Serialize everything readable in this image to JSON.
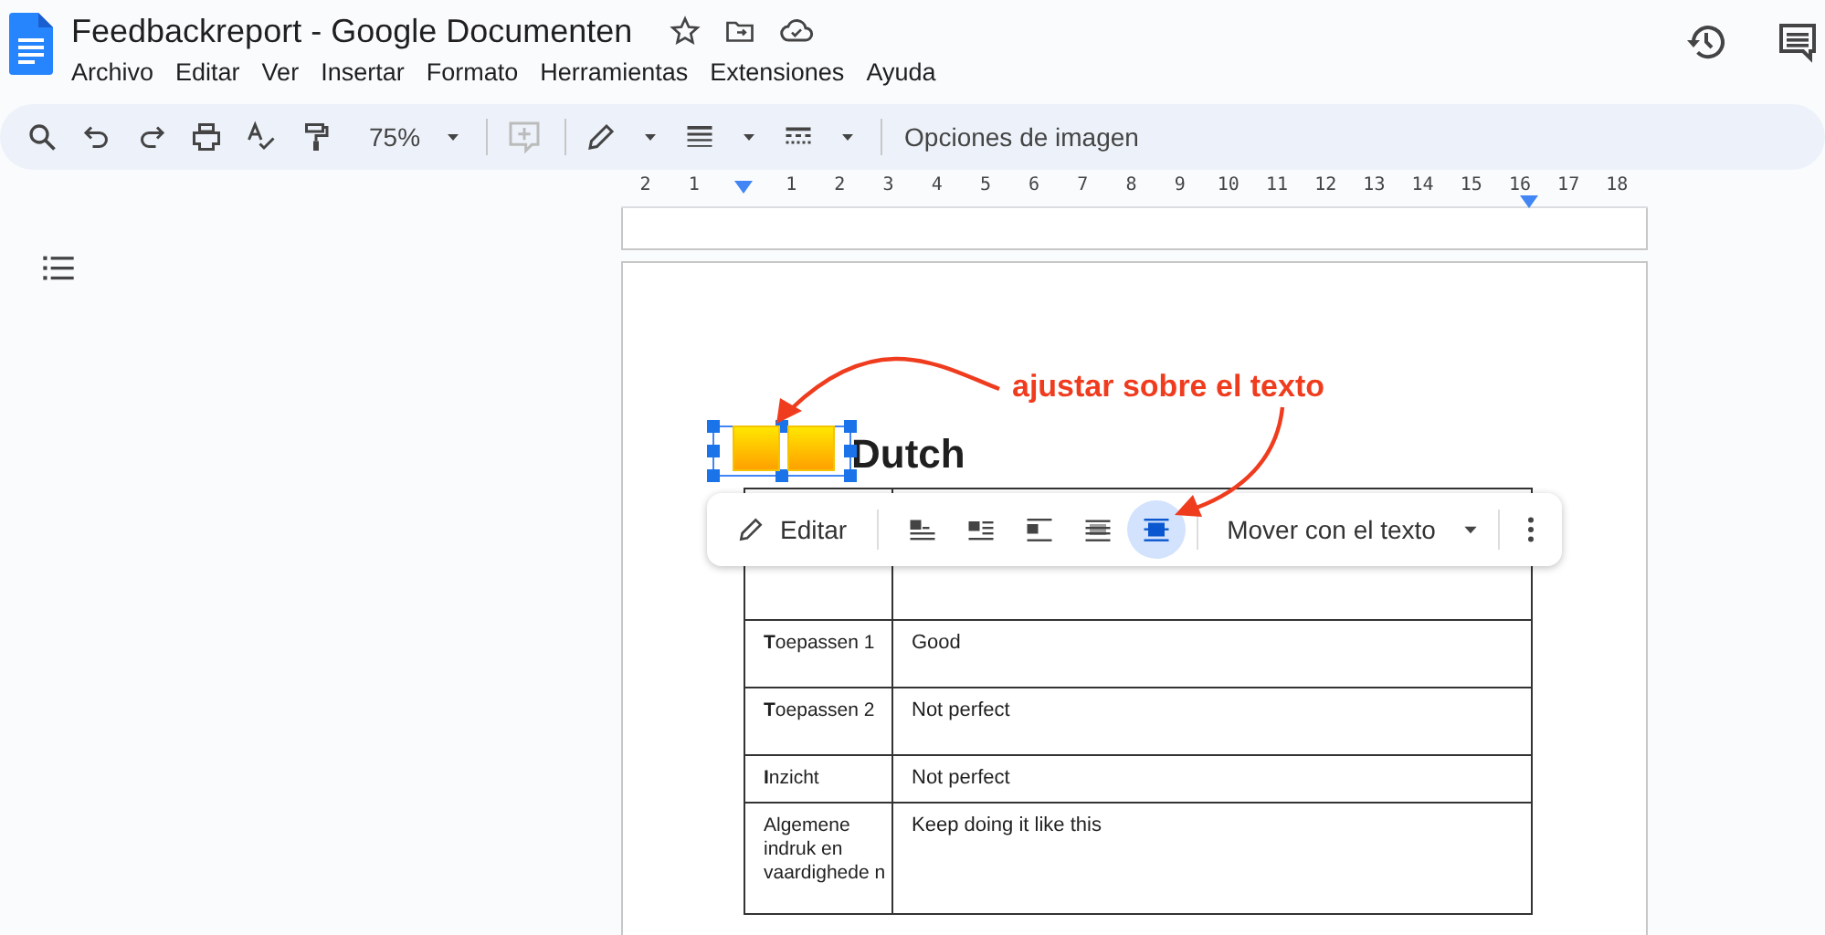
{
  "app": {
    "title": "Feedbackreport - Google Documenten"
  },
  "menu": [
    "Archivo",
    "Editar",
    "Ver",
    "Insertar",
    "Formato",
    "Herramientas",
    "Extensiones",
    "Ayuda"
  ],
  "toolbar": {
    "zoom": "75%",
    "image_options": "Opciones de imagen"
  },
  "ruler": {
    "left_labels": [
      "2",
      "1"
    ],
    "right_labels": [
      "1",
      "2",
      "3",
      "4",
      "5",
      "6",
      "7",
      "8",
      "9",
      "10",
      "11",
      "12",
      "13",
      "14",
      "15",
      "16",
      "17",
      "18"
    ]
  },
  "document": {
    "heading": "Dutch",
    "image_selected": true,
    "table": {
      "rows": [
        {
          "label": "**T**oepassen 1",
          "value": "Good"
        },
        {
          "label": "**T**oepassen 2",
          "value": "Not perfect"
        },
        {
          "label": "**I**nzicht",
          "value": "Not perfect"
        },
        {
          "label": "Algemene indruk en vaardighede n",
          "value": "Keep doing it like this"
        }
      ]
    }
  },
  "image_toolbar": {
    "edit": "Editar",
    "wrap_options": [
      {
        "kind": "inline",
        "selected": false
      },
      {
        "kind": "wrap",
        "selected": false
      },
      {
        "kind": "break",
        "selected": false
      },
      {
        "kind": "behind",
        "selected": false
      },
      {
        "kind": "front",
        "selected": true
      }
    ],
    "position": "Mover con el texto"
  },
  "annotation": {
    "text": "ajustar sobre el texto"
  }
}
